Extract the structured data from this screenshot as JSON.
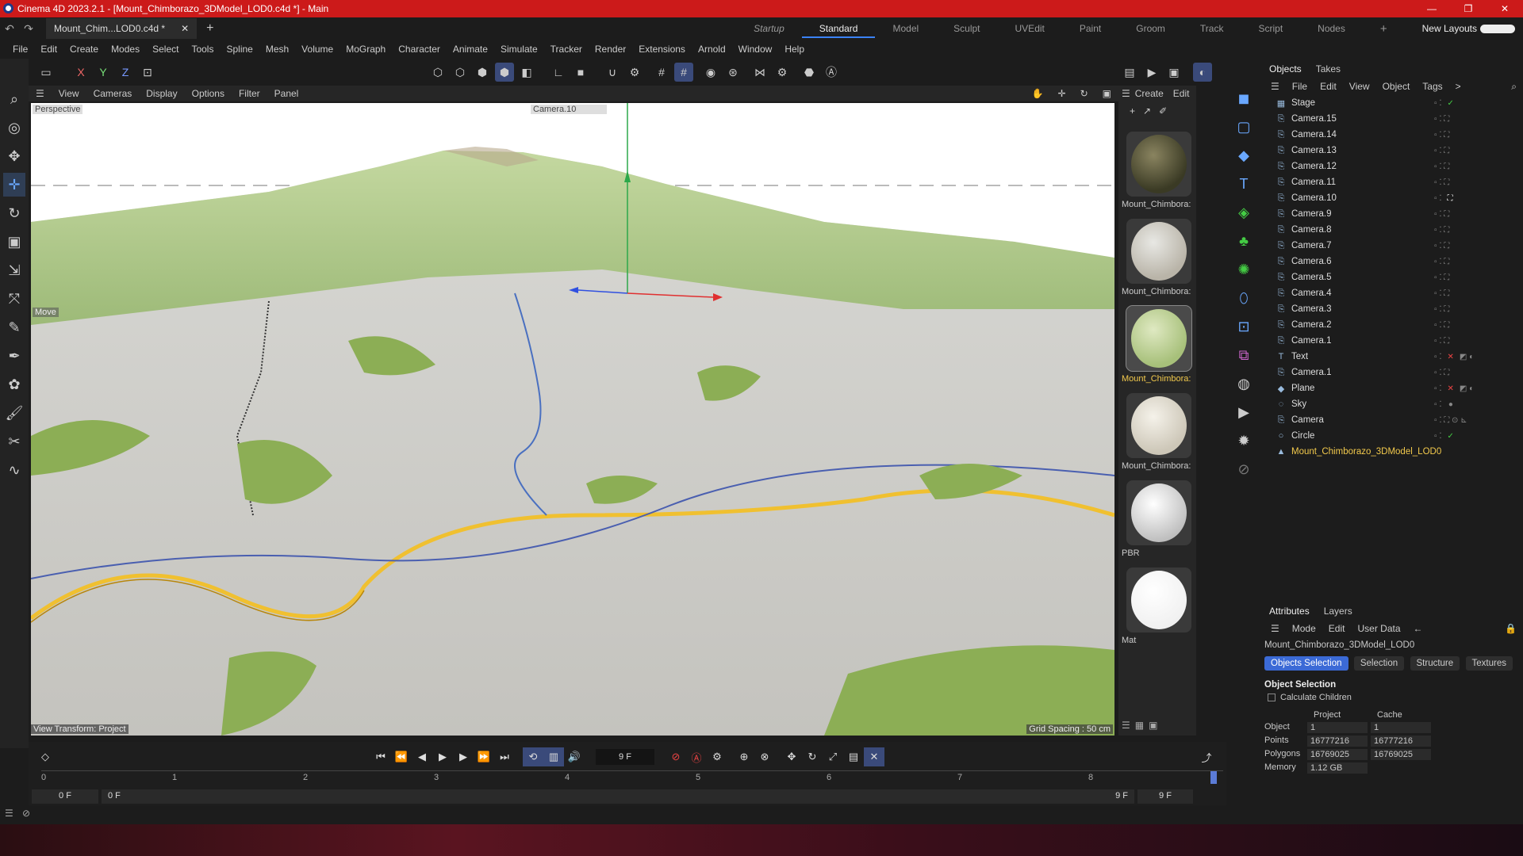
{
  "window": {
    "title": "Cinema 4D 2023.2.1 - [Mount_Chimborazo_3DModel_LOD0.c4d *] - Main",
    "min": "—",
    "max": "❐",
    "close": "✕"
  },
  "doc_tab": {
    "label": "Mount_Chim...LOD0.c4d *",
    "close": "✕",
    "add": "+"
  },
  "layouts": [
    "Startup",
    "Standard",
    "Model",
    "Sculpt",
    "UVEdit",
    "Paint",
    "Groom",
    "Track",
    "Script",
    "Nodes",
    "+",
    "New Layouts"
  ],
  "menu": [
    "File",
    "Edit",
    "Create",
    "Modes",
    "Select",
    "Tools",
    "Spline",
    "Mesh",
    "Volume",
    "MoGraph",
    "Character",
    "Animate",
    "Simulate",
    "Tracker",
    "Render",
    "Extensions",
    "Arnold",
    "Window",
    "Help"
  ],
  "axes": {
    "x": "X",
    "y": "Y",
    "z": "Z"
  },
  "viewport": {
    "menu": [
      "View",
      "Cameras",
      "Display",
      "Options",
      "Filter",
      "Panel"
    ],
    "mode": "Perspective",
    "camera": "Camera.10",
    "tool": "Move",
    "transform": "View Transform: Project",
    "grid": "Grid Spacing : 50 cm"
  },
  "materials": {
    "menu": [
      "Create",
      "Edit",
      ">"
    ],
    "items": [
      "Mount_Chimbora:",
      "Mount_Chimbora:",
      "Mount_Chimbora:",
      "Mount_Chimbora:",
      "PBR",
      "Mat"
    ]
  },
  "objects_panel": {
    "tabs": [
      "Objects",
      "Takes"
    ],
    "menu": [
      "File",
      "Edit",
      "View",
      "Object",
      "Tags",
      ">"
    ],
    "rows": [
      "Stage",
      "Camera.15",
      "Camera.14",
      "Camera.13",
      "Camera.12",
      "Camera.11",
      "Camera.10",
      "Camera.9",
      "Camera.8",
      "Camera.7",
      "Camera.6",
      "Camera.5",
      "Camera.4",
      "Camera.3",
      "Camera.2",
      "Camera.1",
      "Text",
      "Camera.1",
      "Plane",
      "Sky",
      "Camera",
      "Circle",
      "Mount_Chimborazo_3DModel_LOD0"
    ]
  },
  "attributes": {
    "tabs": [
      "Attributes",
      "Layers"
    ],
    "menu": [
      "Mode",
      "Edit",
      "User Data"
    ],
    "object_name": "Mount_Chimborazo_3DModel_LOD0",
    "buttons": [
      "Objects Selection",
      "Selection",
      "Structure",
      "Textures"
    ],
    "section": "Object Selection",
    "checkbox": "Calculate Children",
    "col_project": "Project",
    "col_cache": "Cache",
    "rows": [
      {
        "label": "Object",
        "project": "1",
        "cache": "1"
      },
      {
        "label": "Points",
        "project": "16777216",
        "cache": "16777216"
      },
      {
        "label": "Polygons",
        "project": "16769025",
        "cache": "16769025"
      },
      {
        "label": "Memory",
        "project": "1.12 GB",
        "cache": ""
      }
    ]
  },
  "timeline": {
    "current": "9 F",
    "ticks": [
      "0",
      "1",
      "2",
      "3",
      "4",
      "5",
      "6",
      "7",
      "8"
    ],
    "start": "0 F",
    "start2": "0 F",
    "end": "9 F",
    "end2": "9 F"
  }
}
